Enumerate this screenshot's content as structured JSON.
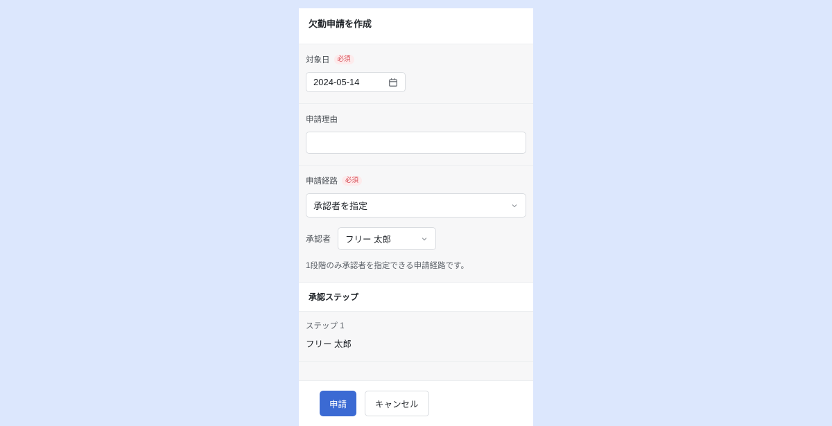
{
  "modal": {
    "title": "欠勤申請を作成"
  },
  "target_date": {
    "label": "対象日",
    "required_badge": "必須",
    "value": "2024-05-14"
  },
  "reason": {
    "label": "申請理由",
    "value": ""
  },
  "route": {
    "label": "申請経路",
    "required_badge": "必須",
    "selected": "承認者を指定",
    "approver_label": "承認者",
    "approver_selected": "フリー 太郎",
    "help_text": "1段階のみ承認者を指定できる申請経路です。"
  },
  "approval_steps": {
    "title": "承認ステップ",
    "step_label": "ステップ 1",
    "step_name": "フリー 太郎"
  },
  "footer": {
    "submit": "申請",
    "cancel": "キャンセル"
  }
}
